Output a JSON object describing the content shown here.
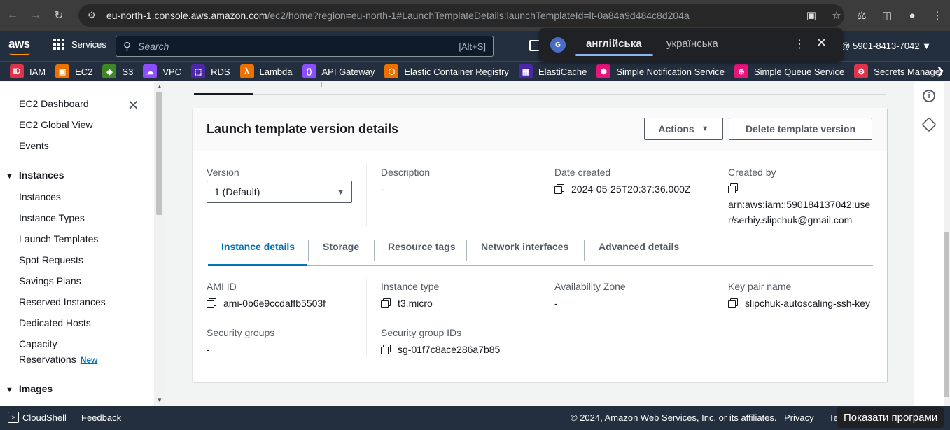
{
  "browser": {
    "url_host": "eu-north-1.console.aws.amazon.com",
    "url_path": "/ec2/home?region=eu-north-1#LaunchTemplateDetails:launchTemplateId=lt-0a84a9d484c8d204a"
  },
  "aws_nav": {
    "logo": "aws",
    "services_label": "Services",
    "search_placeholder": "Search",
    "search_shortcut": "[Alt+S]",
    "account": "m @ 5901-8413-7042 ▼"
  },
  "favorites": [
    {
      "label": "IAM",
      "color": "#dd344c",
      "glyph": "ID"
    },
    {
      "label": "EC2",
      "color": "#ed7100",
      "glyph": "▣"
    },
    {
      "label": "S3",
      "color": "#3f8624",
      "glyph": "◈"
    },
    {
      "label": "VPC",
      "color": "#8c4fff",
      "glyph": "☁"
    },
    {
      "label": "RDS",
      "color": "#4d27aa",
      "glyph": "⬚"
    },
    {
      "label": "Lambda",
      "color": "#ed7100",
      "glyph": "λ"
    },
    {
      "label": "API Gateway",
      "color": "#8c4fff",
      "glyph": "⟨⟩"
    },
    {
      "label": "Elastic Container Registry",
      "color": "#ed7100",
      "glyph": "⬡"
    },
    {
      "label": "ElastiCache",
      "color": "#4d27aa",
      "glyph": "▦"
    },
    {
      "label": "Simple Notification Service",
      "color": "#e7157b",
      "glyph": "✺"
    },
    {
      "label": "Simple Queue Service",
      "color": "#e7157b",
      "glyph": "⊕"
    },
    {
      "label": "Secrets Manager",
      "color": "#dd344c",
      "glyph": "⚙"
    }
  ],
  "translate_popup": {
    "active_lang": "англійська",
    "other_lang": "українська"
  },
  "sidebar": {
    "items": [
      "EC2 Dashboard",
      "EC2 Global View",
      "Events"
    ],
    "instances_heading": "Instances",
    "instances_items": [
      "Instances",
      "Instance Types",
      "Launch Templates",
      "Spot Requests",
      "Savings Plans",
      "Reserved Instances",
      "Dedicated Hosts"
    ],
    "capacity_line1": "Capacity",
    "capacity_line2": "Reservations",
    "new_badge": "New",
    "images_heading": "Images"
  },
  "panel": {
    "title": "Launch template version details",
    "actions_label": "Actions",
    "delete_label": "Delete template version",
    "version_label": "Version",
    "version_value": "1 (Default)",
    "description_label": "Description",
    "description_value": "-",
    "date_label": "Date created",
    "date_value": "2024-05-25T20:37:36.000Z",
    "created_by_label": "Created by",
    "created_by_line1": "arn:aws:iam::590184137042:use",
    "created_by_line2": "r/serhiy.slipchuk@gmail.com"
  },
  "tabs": [
    "Instance details",
    "Storage",
    "Resource tags",
    "Network interfaces",
    "Advanced details"
  ],
  "details": {
    "ami_label": "AMI ID",
    "ami_value": "ami-0b6e9ccdaffb5503f",
    "type_label": "Instance type",
    "type_value": "t3.micro",
    "az_label": "Availability Zone",
    "az_value": "-",
    "key_label": "Key pair name",
    "key_value": "slipchuk-autoscaling-ssh-key",
    "sg_label": "Security groups",
    "sg_value": "-",
    "sgid_label": "Security group IDs",
    "sgid_value": "sg-01f7c8ace286a7b85"
  },
  "footer": {
    "cloudshell": "CloudShell",
    "feedback": "Feedback",
    "copyright": "© 2024, Amazon Web Services, Inc. or its affiliates.",
    "privacy": "Privacy",
    "terms": "Te"
  },
  "toast": "Показати програми"
}
